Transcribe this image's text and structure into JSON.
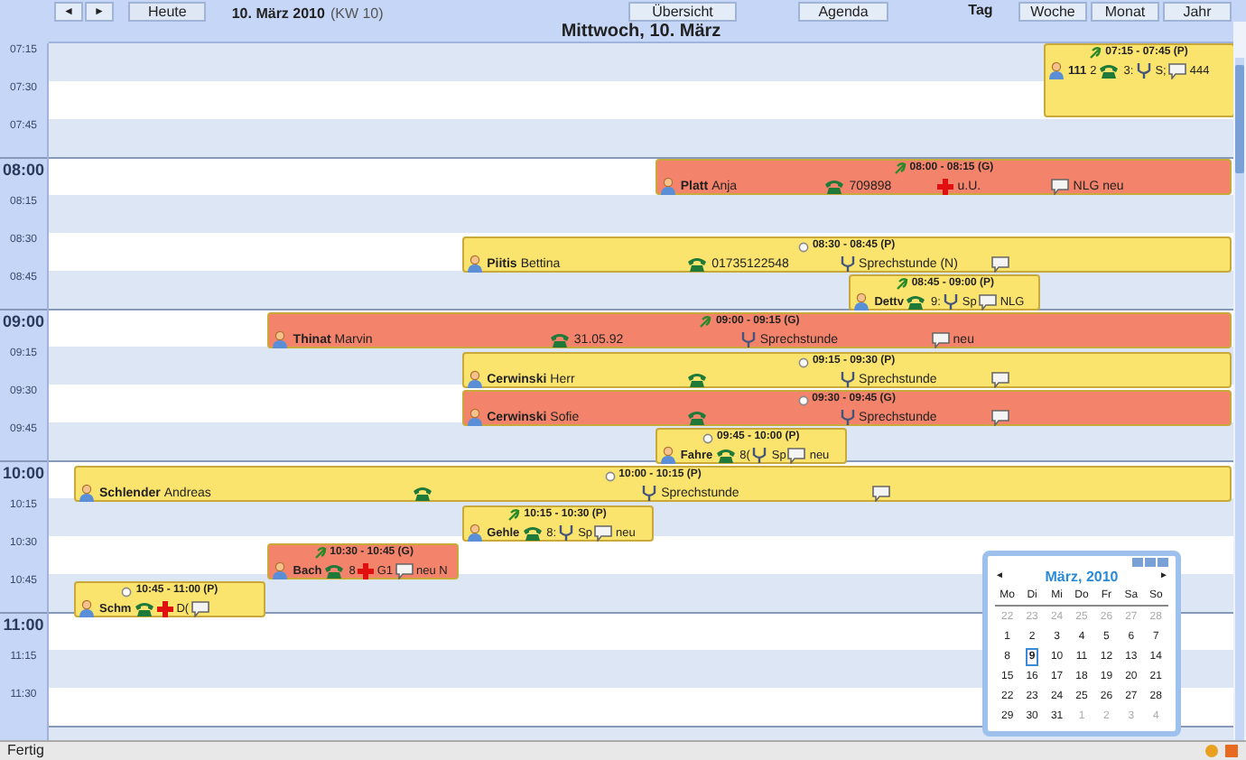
{
  "toolbar": {
    "prev": "◄",
    "next": "►",
    "today": "Heute",
    "date": "10. März 2010",
    "week": "(KW 10)",
    "overview": "Übersicht",
    "agenda": "Agenda"
  },
  "view_tabs": [
    {
      "label": "Tag",
      "selected": true
    },
    {
      "label": "Woche",
      "selected": false
    },
    {
      "label": "Monat",
      "selected": false
    },
    {
      "label": "Jahr",
      "selected": false
    }
  ],
  "day_header": "Mittwoch, 10. März",
  "time_slots": [
    {
      "label": "07:15",
      "kind": "quarter"
    },
    {
      "label": "07:30",
      "kind": "quarter"
    },
    {
      "label": "07:45",
      "kind": "quarter"
    },
    {
      "label": "08:00",
      "kind": "hour"
    },
    {
      "label": "08:15",
      "kind": "quarter"
    },
    {
      "label": "08:30",
      "kind": "quarter"
    },
    {
      "label": "08:45",
      "kind": "quarter"
    },
    {
      "label": "09:00",
      "kind": "hour"
    },
    {
      "label": "09:15",
      "kind": "quarter"
    },
    {
      "label": "09:30",
      "kind": "quarter"
    },
    {
      "label": "09:45",
      "kind": "quarter"
    },
    {
      "label": "10:00",
      "kind": "hour"
    },
    {
      "label": "10:15",
      "kind": "quarter"
    },
    {
      "label": "10:30",
      "kind": "quarter"
    },
    {
      "label": "10:45",
      "kind": "quarter"
    },
    {
      "label": "11:00",
      "kind": "hour"
    },
    {
      "label": "11:15",
      "kind": "quarter"
    },
    {
      "label": "11:30",
      "kind": "quarter"
    }
  ],
  "appointments": [
    {
      "time": "07:15 - 07:45 (P)",
      "color": "#fbe46e",
      "kind": "leaf",
      "parts": [
        {
          "kind": "person",
          "name": "111",
          "first": "2"
        },
        {
          "kind": "phone",
          "text": "3:"
        },
        {
          "kind": "stethoscope",
          "text": "S;"
        },
        {
          "kind": "comment",
          "text": "444"
        }
      ]
    },
    {
      "time": "08:00 - 08:15 (G)",
      "color": "#f4836b",
      "kind": "leaf",
      "parts": [
        {
          "kind": "person",
          "name": "Platt",
          "first": "Anja"
        },
        {
          "kind": "phone",
          "text": "709898"
        },
        {
          "kind": "cross",
          "text": "u.U."
        },
        {
          "kind": "comment",
          "text": "NLG neu"
        }
      ]
    },
    {
      "time": "08:30 - 08:45 (P)",
      "color": "#fbe46e",
      "kind": "circle",
      "parts": [
        {
          "kind": "person",
          "name": "Piitis",
          "first": "Bettina"
        },
        {
          "kind": "phone",
          "text": "01735122548"
        },
        {
          "kind": "stethoscope",
          "text": "Sprechstunde (N)"
        },
        {
          "kind": "comment"
        }
      ]
    },
    {
      "time": "08:45 - 09:00 (P)",
      "color": "#fbe46e",
      "kind": "leaf",
      "parts": [
        {
          "kind": "person",
          "name": "Dettv"
        },
        {
          "kind": "phone",
          "text": "9:"
        },
        {
          "kind": "stethoscope",
          "text": "Sp"
        },
        {
          "kind": "comment",
          "text": "NLG"
        }
      ]
    },
    {
      "time": "09:00 - 09:15 (G)",
      "color": "#f4836b",
      "kind": "leaf",
      "parts": [
        {
          "kind": "person",
          "name": "Thinat",
          "first": "Marvin"
        },
        {
          "kind": "phone",
          "text": "31.05.92"
        },
        {
          "kind": "stethoscope",
          "text": "Sprechstunde"
        },
        {
          "kind": "comment",
          "text": "neu"
        }
      ]
    },
    {
      "time": "09:15 - 09:30 (P)",
      "color": "#fbe46e",
      "kind": "circle",
      "parts": [
        {
          "kind": "person",
          "name": "Cerwinski",
          "first": "Herr"
        },
        {
          "kind": "phone"
        },
        {
          "kind": "stethoscope",
          "text": "Sprechstunde"
        },
        {
          "kind": "comment"
        }
      ]
    },
    {
      "time": "09:30 - 09:45 (G)",
      "color": "#f4836b",
      "kind": "circle",
      "parts": [
        {
          "kind": "person",
          "name": "Cerwinski",
          "first": "Sofie"
        },
        {
          "kind": "phone"
        },
        {
          "kind": "stethoscope",
          "text": "Sprechstunde"
        },
        {
          "kind": "comment"
        }
      ]
    },
    {
      "time": "09:45 - 10:00 (P)",
      "color": "#fbe46e",
      "kind": "circle",
      "parts": [
        {
          "kind": "person",
          "name": "Fahre"
        },
        {
          "kind": "phone",
          "text": "8("
        },
        {
          "kind": "stethoscope",
          "text": "Sp"
        },
        {
          "kind": "comment",
          "text": "neu"
        }
      ]
    },
    {
      "time": "10:00 - 10:15 (P)",
      "color": "#fbe46e",
      "kind": "circle",
      "parts": [
        {
          "kind": "person",
          "name": "Schlender",
          "first": "Andreas"
        },
        {
          "kind": "phone"
        },
        {
          "kind": "stethoscope",
          "text": "Sprechstunde"
        },
        {
          "kind": "comment"
        }
      ]
    },
    {
      "time": "10:15 - 10:30 (P)",
      "color": "#fbe46e",
      "kind": "leaf",
      "parts": [
        {
          "kind": "person",
          "name": "Gehle"
        },
        {
          "kind": "phone",
          "text": "8:"
        },
        {
          "kind": "stethoscope",
          "text": "Sp"
        },
        {
          "kind": "comment",
          "text": "neu"
        }
      ]
    },
    {
      "time": "10:30 - 10:45 (G)",
      "color": "#f4836b",
      "kind": "leaf",
      "parts": [
        {
          "kind": "person",
          "name": "Bach"
        },
        {
          "kind": "phone",
          "text": "8"
        },
        {
          "kind": "cross",
          "text": "G1"
        },
        {
          "kind": "comment",
          "text": "neu N"
        }
      ]
    },
    {
      "time": "10:45 - 11:00 (P)",
      "color": "#fbe46e",
      "kind": "circle",
      "parts": [
        {
          "kind": "person",
          "name": "Schm"
        },
        {
          "kind": "phone"
        },
        {
          "kind": "cross",
          "text": "D("
        },
        {
          "kind": "comment"
        }
      ]
    }
  ],
  "mini_calendar": {
    "prev": "◄",
    "next": "►",
    "title": "März, 2010",
    "weekdays": [
      "Mo",
      "Di",
      "Mi",
      "Do",
      "Fr",
      "Sa",
      "So"
    ],
    "weeks": [
      [
        {
          "d": "22",
          "other": true,
          "selected": false
        },
        {
          "d": "23",
          "other": true,
          "selected": false
        },
        {
          "d": "24",
          "other": true,
          "selected": false
        },
        {
          "d": "25",
          "other": true,
          "selected": false
        },
        {
          "d": "26",
          "other": true,
          "selected": false
        },
        {
          "d": "27",
          "other": true,
          "selected": false
        },
        {
          "d": "28",
          "other": true,
          "selected": false
        }
      ],
      [
        {
          "d": "1",
          "other": false,
          "selected": false
        },
        {
          "d": "2",
          "other": false,
          "selected": false
        },
        {
          "d": "3",
          "other": false,
          "selected": false
        },
        {
          "d": "4",
          "other": false,
          "selected": false
        },
        {
          "d": "5",
          "other": false,
          "selected": false
        },
        {
          "d": "6",
          "other": false,
          "selected": false
        },
        {
          "d": "7",
          "other": false,
          "selected": false
        }
      ],
      [
        {
          "d": "8",
          "other": false,
          "selected": false
        },
        {
          "d": "9",
          "other": false,
          "selected": true
        },
        {
          "d": "10",
          "other": false,
          "selected": false
        },
        {
          "d": "11",
          "other": false,
          "selected": false
        },
        {
          "d": "12",
          "other": false,
          "selected": false
        },
        {
          "d": "13",
          "other": false,
          "selected": false
        },
        {
          "d": "14",
          "other": false,
          "selected": false
        }
      ],
      [
        {
          "d": "15",
          "other": false,
          "selected": false
        },
        {
          "d": "16",
          "other": false,
          "selected": false
        },
        {
          "d": "17",
          "other": false,
          "selected": false
        },
        {
          "d": "18",
          "other": false,
          "selected": false
        },
        {
          "d": "19",
          "other": false,
          "selected": false
        },
        {
          "d": "20",
          "other": false,
          "selected": false
        },
        {
          "d": "21",
          "other": false,
          "selected": false
        }
      ],
      [
        {
          "d": "22",
          "other": false,
          "selected": false
        },
        {
          "d": "23",
          "other": false,
          "selected": false
        },
        {
          "d": "24",
          "other": false,
          "selected": false
        },
        {
          "d": "25",
          "other": false,
          "selected": false
        },
        {
          "d": "26",
          "other": false,
          "selected": false
        },
        {
          "d": "27",
          "other": false,
          "selected": false
        },
        {
          "d": "28",
          "other": false,
          "selected": false
        }
      ],
      [
        {
          "d": "29",
          "other": false,
          "selected": false
        },
        {
          "d": "30",
          "other": false,
          "selected": false
        },
        {
          "d": "31",
          "other": false,
          "selected": false
        },
        {
          "d": "1",
          "other": true,
          "selected": false
        },
        {
          "d": "2",
          "other": true,
          "selected": false
        },
        {
          "d": "3",
          "other": true,
          "selected": false
        },
        {
          "d": "4",
          "other": true,
          "selected": false
        }
      ]
    ]
  },
  "status_bar": {
    "text": "Fertig"
  }
}
